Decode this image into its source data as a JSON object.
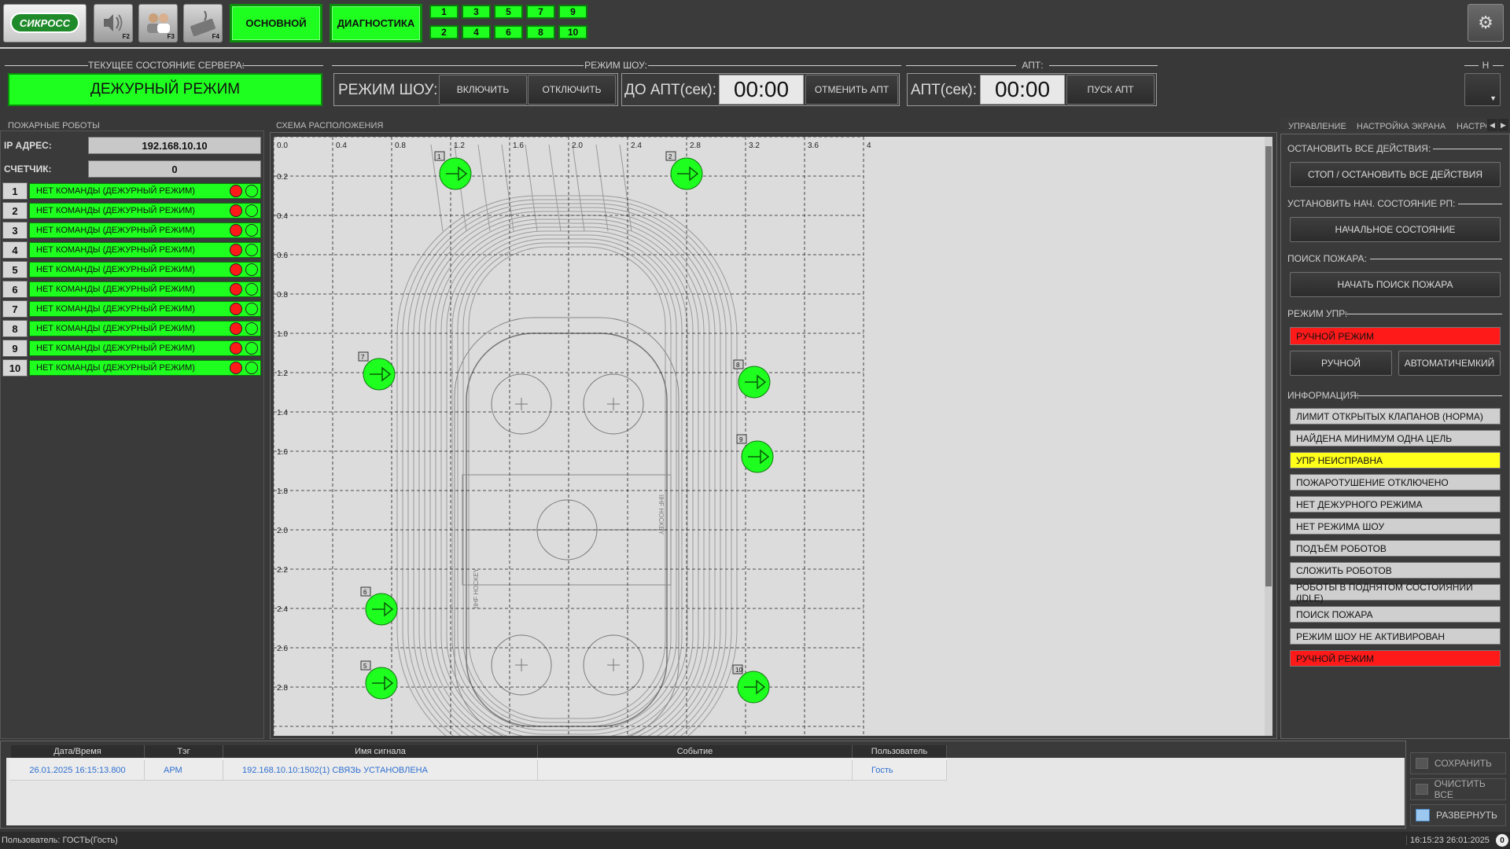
{
  "topbar": {
    "logo_text": "СИКРОСС",
    "f2_key": "F2",
    "f3_key": "F3",
    "f4_key": "F4",
    "mode_main": "ОСНОВНОЙ",
    "mode_diag": "ДИАГНОСТИКА",
    "screens_top": [
      "1",
      "3",
      "5",
      "7",
      "9"
    ],
    "screens_bottom": [
      "2",
      "4",
      "6",
      "8",
      "10"
    ]
  },
  "server": {
    "title": "ТЕКУЩЕЕ СОСТОЯНИЕ СЕРВЕРА:",
    "state": "ДЕЖУРНЫЙ РЕЖИМ"
  },
  "show": {
    "title": "РЕЖИМ ШОУ:",
    "label": "РЕЖИМ ШОУ:",
    "on": "ВКЛЮЧИТЬ",
    "off": "ОТКЛЮЧИТЬ",
    "to_apt_label": "ДО АПТ(сек):",
    "to_apt_value": "00:00",
    "cancel_apt": "ОТМЕНИТЬ АПТ"
  },
  "apt": {
    "title": "АПТ:",
    "label": "АПТ(сек):",
    "value": "00:00",
    "start": "ПУСК АПТ"
  },
  "h_group": {
    "title": "Н"
  },
  "robots_panel": {
    "title": "ПОЖАРНЫЕ РОБОТЫ",
    "ip_label": "IP АДРЕС:",
    "ip_value": "192.168.10.10",
    "counter_label": "СЧЕТЧИК:",
    "counter_value": "0",
    "robots": [
      {
        "num": "1",
        "status": "НЕТ КОМАНДЫ (ДЕЖУРНЫЙ РЕЖИМ)"
      },
      {
        "num": "2",
        "status": "НЕТ КОМАНДЫ (ДЕЖУРНЫЙ РЕЖИМ)"
      },
      {
        "num": "3",
        "status": "НЕТ КОМАНДЫ (ДЕЖУРНЫЙ РЕЖИМ)"
      },
      {
        "num": "4",
        "status": "НЕТ КОМАНДЫ (ДЕЖУРНЫЙ РЕЖИМ)"
      },
      {
        "num": "5",
        "status": "НЕТ КОМАНДЫ (ДЕЖУРНЫЙ РЕЖИМ)"
      },
      {
        "num": "6",
        "status": "НЕТ КОМАНДЫ (ДЕЖУРНЫЙ РЕЖИМ)"
      },
      {
        "num": "7",
        "status": "НЕТ КОМАНДЫ (ДЕЖУРНЫЙ РЕЖИМ)"
      },
      {
        "num": "8",
        "status": "НЕТ КОМАНДЫ (ДЕЖУРНЫЙ РЕЖИМ)"
      },
      {
        "num": "9",
        "status": "НЕТ КОМАНДЫ (ДЕЖУРНЫЙ РЕЖИМ)"
      },
      {
        "num": "10",
        "status": "НЕТ КОМАНДЫ (ДЕЖУРНЫЙ РЕЖИМ)"
      }
    ]
  },
  "scheme": {
    "title": "СХЕМА РАСПОЛОЖЕНИЯ",
    "x_ticks": [
      "0.0",
      "0.4",
      "0.8",
      "1.2",
      "1.6",
      "2.0",
      "2.4",
      "2.8",
      "3.2",
      "3.6",
      "4"
    ],
    "y_ticks": [
      "0.2",
      "0.4",
      "0.6",
      "0.8",
      "1.0",
      "1.2",
      "1.4",
      "1.6",
      "1.8",
      "2.0",
      "2.2",
      "2.4",
      "2.6",
      "2.8"
    ],
    "rink_text": "IIHF HOCKEY",
    "markers": [
      "1",
      "2",
      "7",
      "8",
      "9",
      "6",
      "5",
      "10"
    ]
  },
  "right_panel": {
    "tabs": [
      "УПРАВЛЕНИЕ",
      "НАСТРОЙКА ЭКРАНА",
      "НАСТРО"
    ],
    "stop_title": "ОСТАНОВИТЬ ВСЕ ДЕЙСТВИЯ:",
    "stop_btn": "СТОП / ОСТАНОВИТЬ ВСЕ ДЕЙСТВИЯ",
    "init_title": "УСТАНОВИТЬ НАЧ. СОСТОЯНИЕ РП:",
    "init_btn": "НАЧАЛЬНОЕ СОСТОЯНИЕ",
    "search_title": "ПОИСК ПОЖАРА:",
    "search_btn": "НАЧАТЬ ПОИСК ПОЖАРА",
    "upr_title": "РЕЖИМ УПР:",
    "upr_state": "РУЧНОЙ РЕЖИМ",
    "manual_btn": "РУЧНОЙ",
    "auto_btn": "АВТОМАТИЧЕМКИЙ",
    "info_title": "ИНФОРМАЦИЯ:",
    "info_rows": [
      {
        "text": "ЛИМИТ ОТКРЫТЫХ КЛАПАНОВ (НОРМА)",
        "color": "#cfcfcf"
      },
      {
        "text": "НАЙДЕНА МИНИМУМ ОДНА ЦЕЛЬ",
        "color": "#cfcfcf"
      },
      {
        "text": "УПР НЕИСПРАВНА",
        "color": "#ffff1a"
      },
      {
        "text": "ПОЖАРОТУШЕНИЕ ОТКЛЮЧЕНО",
        "color": "#cfcfcf"
      },
      {
        "text": "НЕТ ДЕЖУРНОГО РЕЖИМА",
        "color": "#cfcfcf"
      },
      {
        "text": "НЕТ РЕЖИМА ШОУ",
        "color": "#cfcfcf"
      },
      {
        "text": "ПОДЪЁМ РОБОТОВ",
        "color": "#cfcfcf"
      },
      {
        "text": "СЛОЖИТЬ РОБОТОВ",
        "color": "#cfcfcf"
      },
      {
        "text": "РОБОТЫ В ПОДНЯТОМ СОСТОИЯНИИ (IDLE)",
        "color": "#cfcfcf"
      },
      {
        "text": "ПОИСК ПОЖАРА",
        "color": "#cfcfcf"
      },
      {
        "text": "РЕЖИМ ШОУ НЕ АКТИВИРОВАН",
        "color": "#cfcfcf"
      },
      {
        "text": "РУЧНОЙ РЕЖИМ",
        "color": "#ff1a1a"
      }
    ]
  },
  "log": {
    "headers": [
      "Дата/Время",
      "Тэг",
      "Имя сигнала",
      "Событие",
      "Пользователь"
    ],
    "rows": [
      {
        "datetime": "26.01.2025 16:15:13.800",
        "tag": "АРМ",
        "signal": "192.168.10.10:1502(1) СВЯЗЬ УСТАНОВЛЕНА",
        "event": "",
        "user": "Гость"
      }
    ],
    "save": "СОХРАНИТЬ",
    "clear": "ОЧИСТИТЬ ВСЕ",
    "expand": "РАЗВЕРНУТЬ"
  },
  "statusbar": {
    "user": "Пользователь: ГОСТЬ(Гость)",
    "clock": "16:15:23 26:01:2025"
  },
  "colors": {
    "green": "#1fff1f",
    "red": "#ff1a1a",
    "yellow": "#ffff1a"
  }
}
